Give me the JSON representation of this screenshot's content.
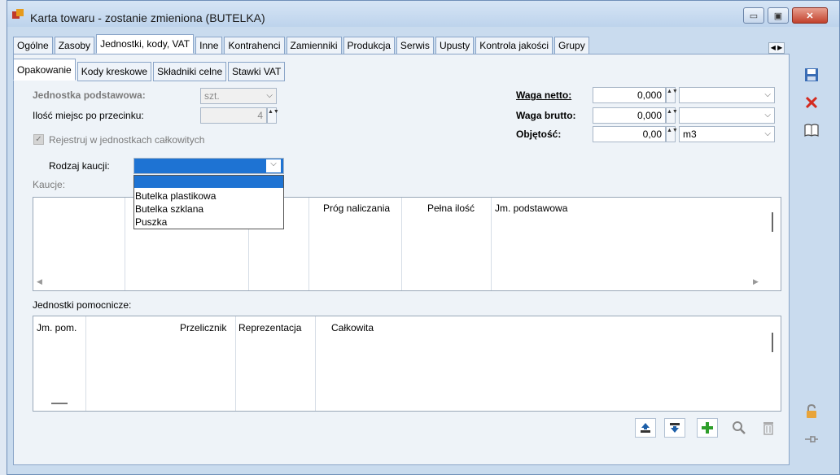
{
  "window": {
    "title": "Karta towaru - zostanie zmieniona (BUTELKA)",
    "minimize": "▭",
    "maximize": "▣",
    "close": "✕"
  },
  "tabs": [
    {
      "label": "Ogólne"
    },
    {
      "label": "Zasoby"
    },
    {
      "label": "Jednostki, kody, VAT"
    },
    {
      "label": "Inne"
    },
    {
      "label": "Kontrahenci"
    },
    {
      "label": "Zamienniki"
    },
    {
      "label": "Produkcja"
    },
    {
      "label": "Serwis"
    },
    {
      "label": "Upusty"
    },
    {
      "label": "Kontrola jakości"
    },
    {
      "label": "Grupy"
    }
  ],
  "active_tab": "Jednostki, kody, VAT",
  "tab_scroll": "◀ ▶",
  "subtabs": [
    {
      "label": "Opakowanie"
    },
    {
      "label": "Kody kreskowe"
    },
    {
      "label": "Składniki celne"
    },
    {
      "label": "Stawki VAT"
    }
  ],
  "form": {
    "jednostka_label": "Jednostka podstawowa:",
    "jednostka_value": "szt.",
    "ilosc_label": "Ilość miejsc po przecinku:",
    "ilosc_value": "4",
    "rejestruj_label": "Rejestruj w jednostkach całkowitych",
    "rejestruj_checked": true,
    "rodzaj_label": "Rodzaj kaucji:",
    "rodzaj_value": "",
    "kaucje_label": "Kaucje:",
    "waga_netto_label": "Waga netto:",
    "waga_netto_value": "0,000",
    "waga_netto_unit": "",
    "waga_brutto_label": "Waga brutto:",
    "waga_brutto_value": "0,000",
    "waga_brutto_unit": "",
    "objetosc_label": "Objętość:",
    "objetosc_value": "0,00",
    "objetosc_unit": "m3"
  },
  "dropdown": {
    "options": [
      "",
      "Butelka plastikowa",
      "Butelka szklana",
      "Puszka"
    ]
  },
  "kaucje_grid": {
    "columns": [
      "Próg naliczania",
      "Pełna ilość",
      "Jm. podstawowa"
    ]
  },
  "pomocnicze": {
    "label": "Jednostki pomocnicze:",
    "columns": [
      "Jm. pom.",
      "Przelicznik",
      "Reprezentacja",
      "Całkowita"
    ]
  },
  "icons": {
    "spin": "▲▼",
    "chevron": "⌵",
    "scroll_left": "◀",
    "scroll_right": "▶"
  },
  "colors": {
    "selection": "#1e73d3",
    "close_button": "#c2412c",
    "add_green": "#2e9e2a"
  }
}
